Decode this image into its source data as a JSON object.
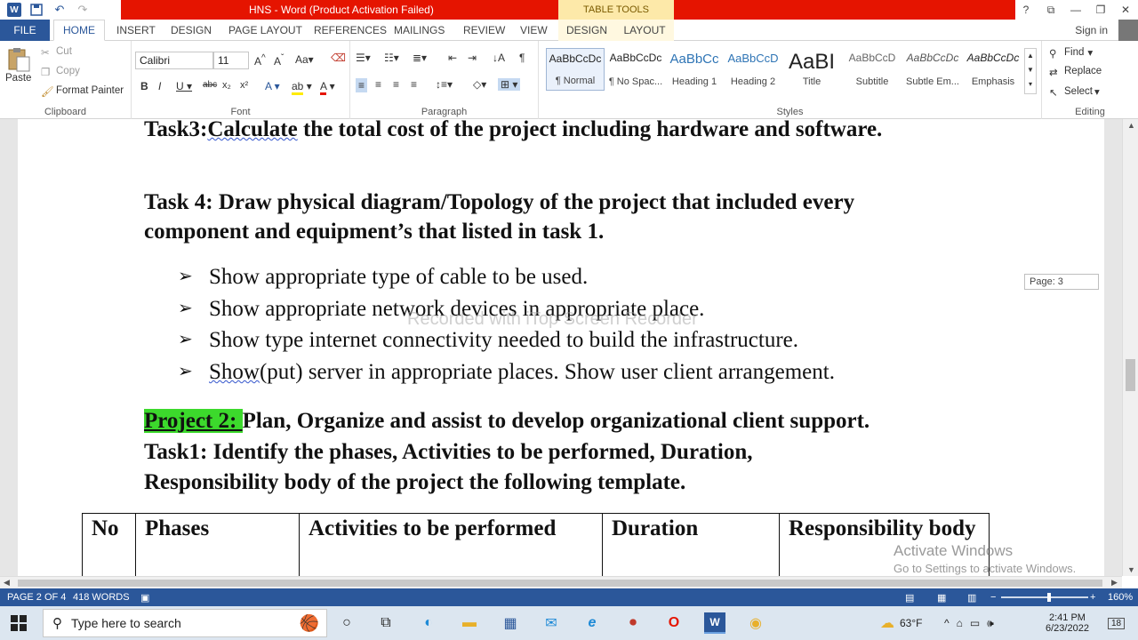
{
  "app": {
    "title": "HNS  -  Word (Product Activation Failed)",
    "table_tools_label": "TABLE TOOLS",
    "window_buttons": [
      "?",
      "⧉",
      "—",
      "❐",
      "✕"
    ]
  },
  "tabs": {
    "file": "FILE",
    "items": [
      "HOME",
      "INSERT",
      "DESIGN",
      "PAGE LAYOUT",
      "REFERENCES",
      "MAILINGS",
      "REVIEW",
      "VIEW"
    ],
    "context": [
      "DESIGN",
      "LAYOUT"
    ],
    "sign_in": "Sign in"
  },
  "ribbon": {
    "clipboard": {
      "label": "Clipboard",
      "paste": "Paste",
      "cut": "Cut",
      "copy": "Copy",
      "format_painter": "Format Painter"
    },
    "font": {
      "label": "Font",
      "name": "Calibri",
      "size": "11"
    },
    "paragraph": {
      "label": "Paragraph"
    },
    "styles": {
      "label": "Styles",
      "items": [
        {
          "sample": "AaBbCcDc",
          "name": "¶ Normal"
        },
        {
          "sample": "AaBbCcDc",
          "name": "¶ No Spac..."
        },
        {
          "sample": "AaBbCc",
          "name": "Heading 1"
        },
        {
          "sample": "AaBbCcD",
          "name": "Heading 2"
        },
        {
          "sample": "AaBI",
          "name": "Title"
        },
        {
          "sample": "AaBbCcD",
          "name": "Subtitle"
        },
        {
          "sample": "AaBbCcDc",
          "name": "Subtle Em..."
        },
        {
          "sample": "AaBbCcDc",
          "name": "Emphasis"
        }
      ]
    },
    "editing": {
      "label": "Editing",
      "find": "Find",
      "replace": "Replace",
      "select": "Select"
    }
  },
  "document": {
    "task3_prefix": "Task3:",
    "task3_link": "Calculate",
    "task3_rest": " the total cost of the project including hardware and software.",
    "task4_line1": "Task 4: Draw physical diagram/Topology of the project that included every",
    "task4_line2": "component and equipment’s that listed in task 1.",
    "bullet_glyph": "➢",
    "bullets": [
      "Show appropriate type of cable to be used.",
      "Show appropriate network devices in appropriate place.",
      "Show type internet connectivity needed to build the infrastructure."
    ],
    "bullet4_underlined": "Show",
    "bullet4_rest": "(put) server in appropriate places. Show user client arrangement.",
    "project2_label": "Project 2: ",
    "project2_rest": "Plan, Organize and assist to develop organizational client support.",
    "task1_line1": "Task1: Identify the phases, Activities to be performed, Duration,",
    "task1_line2": "Responsibility body of the project the following template.",
    "table_headers": [
      "No",
      "Phases",
      "Activities to be performed",
      "Duration",
      "Responsibility body"
    ],
    "page_indicator": "Page: 3",
    "watermark": "Recorded with iTop Screen Recorder"
  },
  "activation": {
    "line1": "Activate Windows",
    "line2": "Go to Settings to activate Windows."
  },
  "status": {
    "page": "PAGE 2 OF 4",
    "words": "418 WORDS",
    "zoom": "160%"
  },
  "taskbar": {
    "search_placeholder": "Type here to search",
    "weather": "63°F",
    "time": "2:41 PM",
    "date": "6/23/2022",
    "notifications": "18"
  }
}
